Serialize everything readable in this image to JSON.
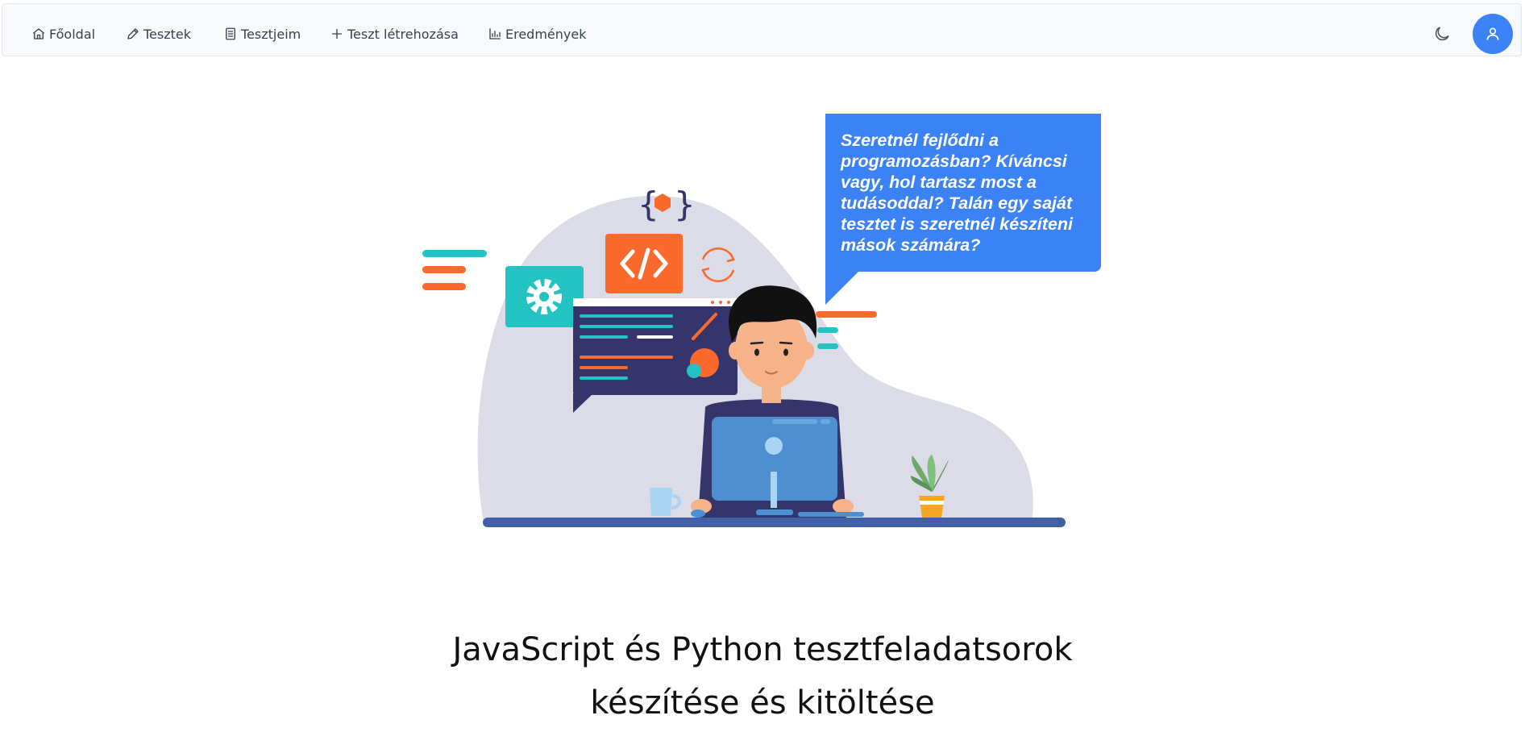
{
  "nav": {
    "items": [
      {
        "label": "Főoldal",
        "icon": "home-icon"
      },
      {
        "label": "Tesztek",
        "icon": "pencil-icon"
      },
      {
        "label": "Tesztjeim",
        "icon": "document-icon"
      },
      {
        "label": "Teszt létrehozása",
        "icon": "plus-icon"
      },
      {
        "label": "Eredmények",
        "icon": "bar-chart-icon"
      }
    ],
    "theme_icon": "moon-icon",
    "avatar_icon": "user-icon"
  },
  "hero": {
    "bubble_text": "Szeretnél fejlődni a programozásban? Kíváncsi vagy, hol tartasz most a tudásoddal? Talán egy saját tesztet is szeretnél készíteni mások számára?",
    "title_line1": "JavaScript és Python tesztfeladatsorok",
    "title_line2": "készítése és kitöltése"
  },
  "colors": {
    "accent": "#3b82f6",
    "orange": "#fb6a2c",
    "teal": "#23c3c3",
    "navy": "#35346b",
    "blob": "#dcdce8"
  }
}
